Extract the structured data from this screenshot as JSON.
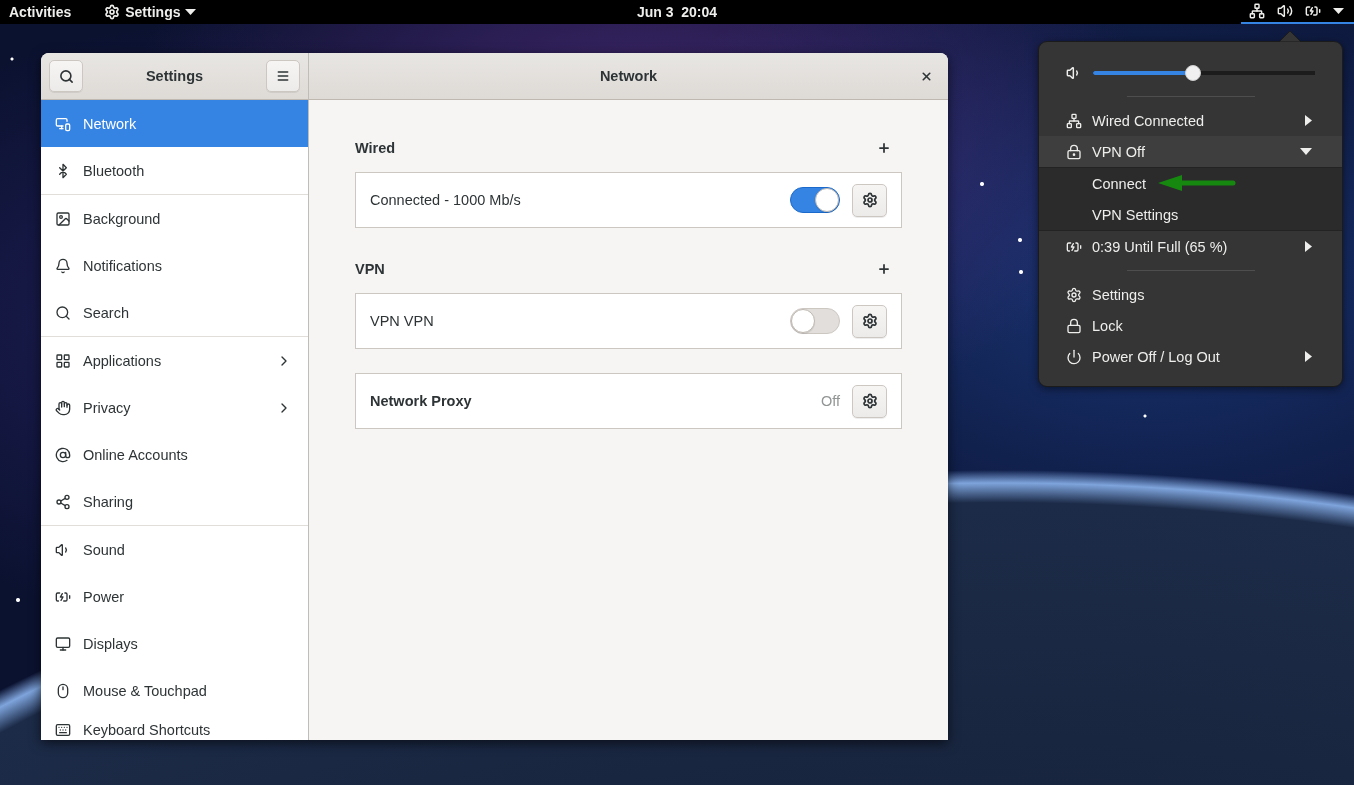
{
  "top_bar": {
    "activities": "Activities",
    "app_menu": "Settings",
    "clock": "Jun 3  20:04"
  },
  "settings_window": {
    "sidebar_title": "Settings",
    "title": "Network",
    "sidebar": {
      "groups": [
        [
          {
            "label": "Network",
            "selected": true,
            "has_submenu": false
          },
          {
            "label": "Bluetooth",
            "selected": false,
            "has_submenu": false
          }
        ],
        [
          {
            "label": "Background",
            "selected": false,
            "has_submenu": false
          },
          {
            "label": "Notifications",
            "selected": false,
            "has_submenu": false
          },
          {
            "label": "Search",
            "selected": false,
            "has_submenu": false
          }
        ],
        [
          {
            "label": "Applications",
            "selected": false,
            "has_submenu": true
          },
          {
            "label": "Privacy",
            "selected": false,
            "has_submenu": true
          },
          {
            "label": "Online Accounts",
            "selected": false,
            "has_submenu": false
          },
          {
            "label": "Sharing",
            "selected": false,
            "has_submenu": false
          }
        ],
        [
          {
            "label": "Sound",
            "selected": false,
            "has_submenu": false
          },
          {
            "label": "Power",
            "selected": false,
            "has_submenu": false
          },
          {
            "label": "Displays",
            "selected": false,
            "has_submenu": false
          },
          {
            "label": "Mouse & Touchpad",
            "selected": false,
            "has_submenu": false
          },
          {
            "label": "Keyboard Shortcuts",
            "selected": false,
            "has_submenu": false
          }
        ]
      ]
    },
    "sections": [
      {
        "heading": "Wired",
        "connections": [
          {
            "label": "Connected - 1000 Mb/s",
            "on": true
          }
        ]
      },
      {
        "heading": "VPN",
        "connections": [
          {
            "label": "VPN VPN",
            "on": false
          }
        ]
      }
    ],
    "proxy": {
      "label": "Network Proxy",
      "status": "Off"
    }
  },
  "system_menu": {
    "volume": {
      "level": 0.45
    },
    "sections": [
      [
        {
          "kind": "submenu",
          "label": "Wired Connected",
          "expanded": false
        },
        {
          "kind": "submenu",
          "label": "VPN Off",
          "expanded": true,
          "children": [
            {
              "label": "Connect"
            },
            {
              "label": "VPN Settings"
            }
          ]
        },
        {
          "kind": "submenu",
          "label": "0:39 Until Full (65 %)",
          "expanded": false
        }
      ],
      [
        {
          "kind": "action",
          "label": "Settings"
        },
        {
          "kind": "action",
          "label": "Lock"
        },
        {
          "kind": "submenu",
          "label": "Power Off / Log Out",
          "expanded": false
        }
      ]
    ]
  }
}
